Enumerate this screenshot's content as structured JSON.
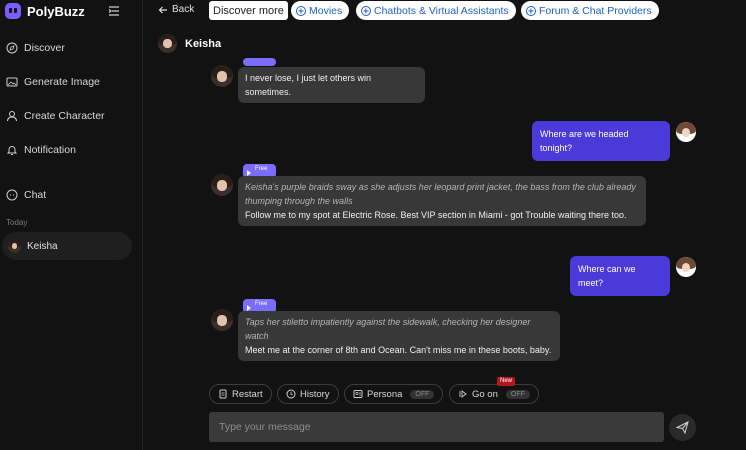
{
  "app": {
    "name": "PolyBuzz"
  },
  "sidebar": {
    "items": [
      {
        "label": "Discover",
        "icon": "compass-icon"
      },
      {
        "label": "Generate Image",
        "icon": "image-icon"
      },
      {
        "label": "Create Character",
        "icon": "user-plus-icon"
      },
      {
        "label": "Notification",
        "icon": "bell-icon"
      },
      {
        "label": "Chat",
        "icon": "chat-icon"
      }
    ],
    "section_label": "Today",
    "chats": [
      {
        "name": "Keisha"
      }
    ]
  },
  "topbar": {
    "back_label": "Back",
    "discover_label": "Discover more",
    "pills": [
      {
        "label": "Movies"
      },
      {
        "label": "Chatbots & Virtual Assistants"
      },
      {
        "label": "Forum & Chat Providers"
      }
    ]
  },
  "chat": {
    "character_name": "Keisha",
    "messages": [
      {
        "from": "bot",
        "text": "I never lose, I just let others win sometimes."
      },
      {
        "from": "user",
        "text": "Where are we headed tonight?"
      },
      {
        "from": "bot",
        "tag": "Free",
        "action": "Keisha's purple braids sway as she adjusts her leopard print jacket, the bass from the club already thumping through the walls",
        "text": "Follow me to my spot at Electric Rose. Best VIP section in Miami - got Trouble waiting there too."
      },
      {
        "from": "user",
        "text": "Where can we meet?"
      },
      {
        "from": "bot",
        "tag": "Free",
        "action": "Taps her stiletto impatiently against the sidewalk, checking her designer watch",
        "text": "Meet me at the corner of 8th and Ocean. Can't miss me in these boots, baby."
      }
    ]
  },
  "actions": {
    "restart": "Restart",
    "history": "History",
    "persona": "Persona",
    "persona_state": "OFF",
    "go_on": "Go on",
    "go_on_state": "OFF",
    "new_badge": "New"
  },
  "composer": {
    "placeholder": "Type your message"
  },
  "colors": {
    "accent": "#4a3ad8",
    "free_tag": "#7a6cff",
    "pill_text": "#1e63c6"
  }
}
